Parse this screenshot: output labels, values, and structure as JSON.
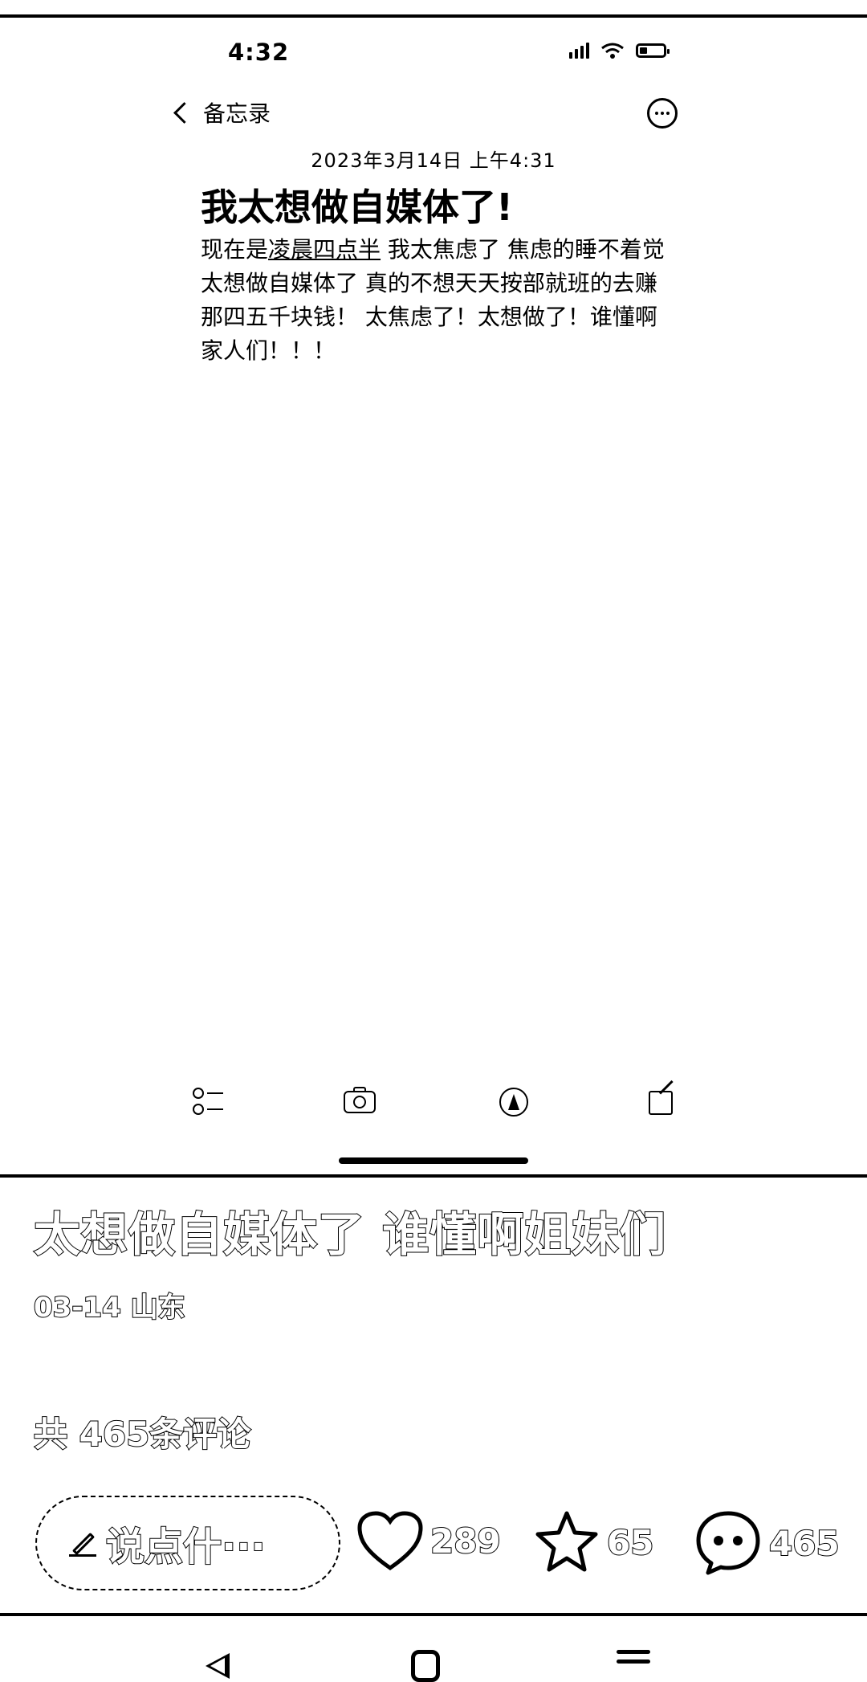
{
  "status_bar": {
    "time": "4:32"
  },
  "notes": {
    "back_label": "备忘录",
    "date": "2023年3月14日 上午4:31",
    "title": "我太想做自媒体了!",
    "body_prefix": "现在是",
    "body_underlined": "凌晨四点半",
    "body_rest": " 我太焦虑了 焦虑的睡不着觉 太想做自媒体了 真的不想天天按部就班的去赚那四五千块钱！ 太焦虑了！太想做了！谁懂啊家人们！！！"
  },
  "post": {
    "title": "太想做自媒体了 谁懂啊姐妹们",
    "meta": "03-14 山东",
    "comment_count_label": "共 465条评论",
    "comment_placeholder": "说点什···",
    "likes": "289",
    "favorites": "65",
    "comments": "465"
  },
  "icons": [
    "wifi-icon",
    "battery-icon",
    "more-icon",
    "checklist-icon",
    "camera-icon",
    "pen-icon",
    "compose-icon",
    "pencil-icon",
    "heart-icon",
    "star-icon",
    "comment-icon",
    "nav-back-icon",
    "nav-home-icon",
    "nav-menu-icon"
  ]
}
